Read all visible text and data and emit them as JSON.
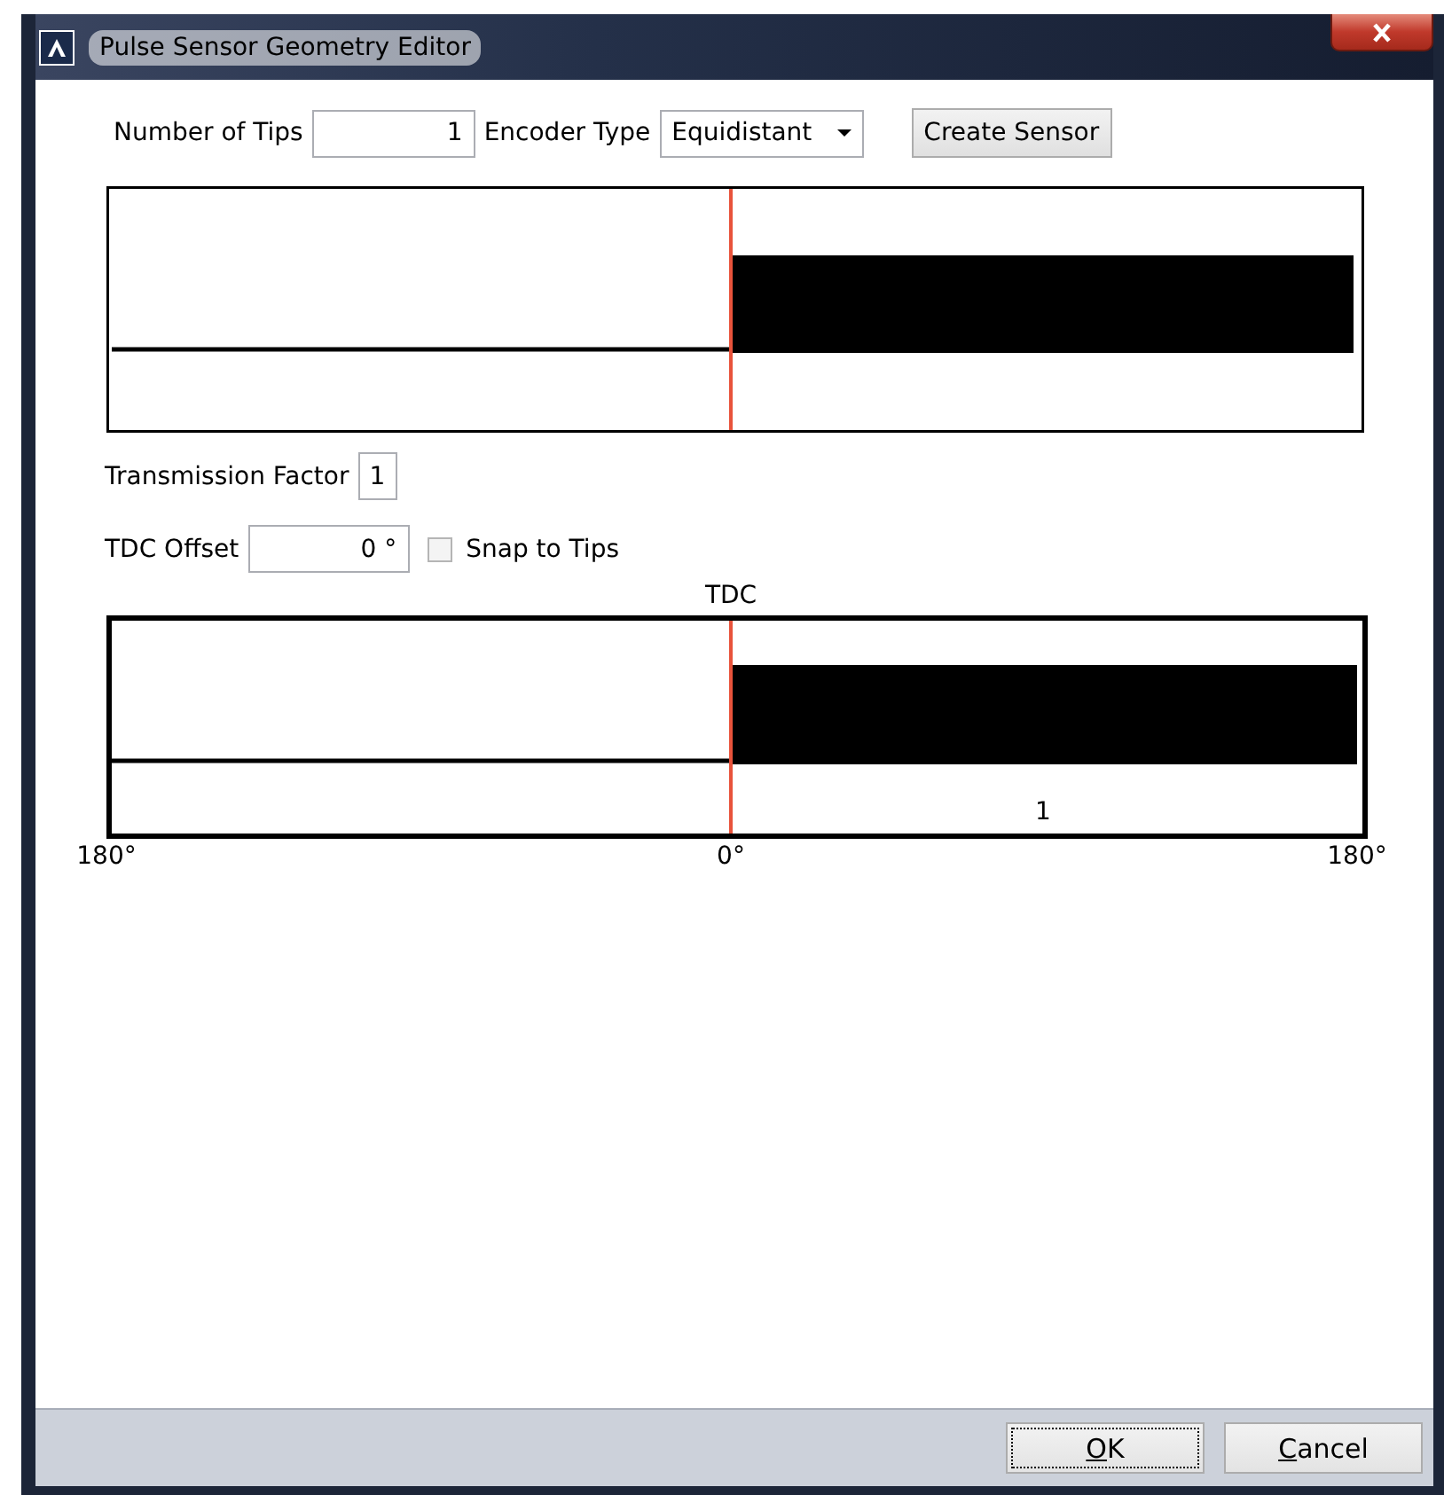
{
  "window": {
    "title": "Pulse Sensor Geometry Editor"
  },
  "toolbar": {
    "tips_label": "Number of Tips",
    "tips_value": "1",
    "encoder_label": "Encoder Type",
    "encoder_value": "Equidistant",
    "create_button": "Create Sensor"
  },
  "transmission": {
    "label": "Transmission Factor",
    "value": "1"
  },
  "tdc_offset": {
    "label": "TDC Offset",
    "value": "0 °",
    "snap_label": "Snap to Tips",
    "snap_checked": false
  },
  "timing_diagram": {
    "marker_label": "TDC",
    "tip_label": "1",
    "axis_labels": [
      "180°",
      "0°",
      "180°"
    ]
  },
  "buttons": [
    {
      "label": "OK",
      "focused": true
    },
    {
      "label": "Cancel",
      "focused": false
    }
  ]
}
